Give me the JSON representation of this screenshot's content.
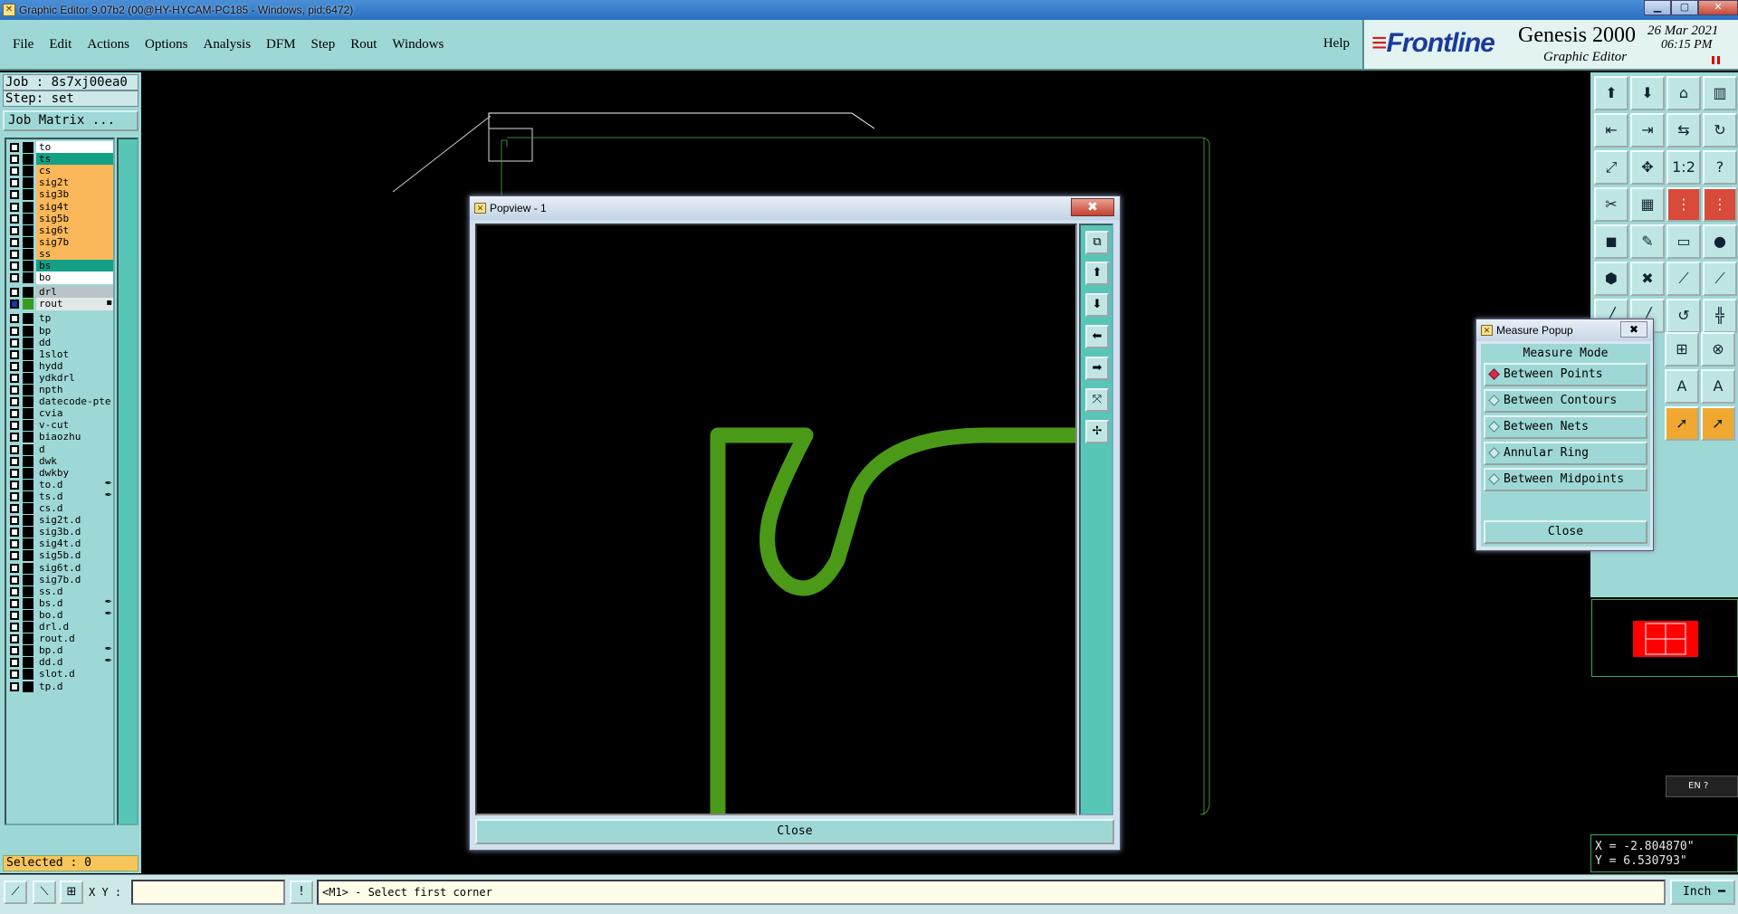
{
  "window": {
    "title": "Graphic Editor 9.07b2 (00@HY-HYCAM-PC185 - Windows, pid:6472)"
  },
  "menu": {
    "items": [
      "File",
      "Edit",
      "Actions",
      "Options",
      "Analysis",
      "DFM",
      "Step",
      "Rout",
      "Windows"
    ],
    "help": "Help"
  },
  "brand": {
    "logo": "Frontline",
    "product": "Genesis 2000",
    "subtitle": "Graphic Editor",
    "date": "26 Mar 2021",
    "time": "06:15 PM"
  },
  "job": {
    "job_label": "Job : 8s7xj00ea0",
    "step_label": "Step: set",
    "matrix_button": "Job Matrix ..."
  },
  "layers": [
    {
      "name": "to",
      "color": "#ffffff",
      "mark": ""
    },
    {
      "name": "ts",
      "color": "#13a085",
      "mark": ""
    },
    {
      "name": "cs",
      "color": "#fbb85a",
      "mark": ""
    },
    {
      "name": "sig2t",
      "color": "#fbb85a",
      "mark": ""
    },
    {
      "name": "sig3b",
      "color": "#fbb85a",
      "mark": ""
    },
    {
      "name": "sig4t",
      "color": "#fbb85a",
      "mark": ""
    },
    {
      "name": "sig5b",
      "color": "#fbb85a",
      "mark": ""
    },
    {
      "name": "sig6t",
      "color": "#fbb85a",
      "mark": ""
    },
    {
      "name": "sig7b",
      "color": "#fbb85a",
      "mark": ""
    },
    {
      "name": "ss",
      "color": "#fbb85a",
      "mark": ""
    },
    {
      "name": "bs",
      "color": "#13a085",
      "mark": ""
    },
    {
      "name": "bo",
      "color": "#ffffff",
      "mark": ""
    },
    {
      "name": "drl",
      "color": "#b8c4c6",
      "mark": ""
    },
    {
      "name": "rout",
      "color": "#e2e8e8",
      "mark": "▪"
    },
    {
      "name": "tp",
      "color": "#9ed8d6",
      "mark": ""
    },
    {
      "name": "bp",
      "color": "#9ed8d6",
      "mark": ""
    },
    {
      "name": "dd",
      "color": "#9ed8d6",
      "mark": ""
    },
    {
      "name": "1slot",
      "color": "#9ed8d6",
      "mark": ""
    },
    {
      "name": "hydd",
      "color": "#9ed8d6",
      "mark": ""
    },
    {
      "name": "ydkdrl",
      "color": "#9ed8d6",
      "mark": ""
    },
    {
      "name": "npth",
      "color": "#9ed8d6",
      "mark": ""
    },
    {
      "name": "datecode-pte",
      "color": "#9ed8d6",
      "mark": ""
    },
    {
      "name": "cvia",
      "color": "#9ed8d6",
      "mark": ""
    },
    {
      "name": "v-cut",
      "color": "#9ed8d6",
      "mark": ""
    },
    {
      "name": "biaozhu",
      "color": "#9ed8d6",
      "mark": ""
    },
    {
      "name": "d",
      "color": "#9ed8d6",
      "mark": ""
    },
    {
      "name": "dwk",
      "color": "#9ed8d6",
      "mark": ""
    },
    {
      "name": "dwkby",
      "color": "#9ed8d6",
      "mark": ""
    },
    {
      "name": "to.d",
      "color": "#9ed8d6",
      "mark": "✒"
    },
    {
      "name": "ts.d",
      "color": "#9ed8d6",
      "mark": "✒"
    },
    {
      "name": "cs.d",
      "color": "#9ed8d6",
      "mark": ""
    },
    {
      "name": "sig2t.d",
      "color": "#9ed8d6",
      "mark": ""
    },
    {
      "name": "sig3b.d",
      "color": "#9ed8d6",
      "mark": ""
    },
    {
      "name": "sig4t.d",
      "color": "#9ed8d6",
      "mark": ""
    },
    {
      "name": "sig5b.d",
      "color": "#9ed8d6",
      "mark": ""
    },
    {
      "name": "sig6t.d",
      "color": "#9ed8d6",
      "mark": ""
    },
    {
      "name": "sig7b.d",
      "color": "#9ed8d6",
      "mark": ""
    },
    {
      "name": "ss.d",
      "color": "#9ed8d6",
      "mark": ""
    },
    {
      "name": "bs.d",
      "color": "#9ed8d6",
      "mark": "✒"
    },
    {
      "name": "bo.d",
      "color": "#9ed8d6",
      "mark": "✒"
    },
    {
      "name": "drl.d",
      "color": "#9ed8d6",
      "mark": ""
    },
    {
      "name": "rout.d",
      "color": "#9ed8d6",
      "mark": ""
    },
    {
      "name": "bp.d",
      "color": "#9ed8d6",
      "mark": "✒"
    },
    {
      "name": "dd.d",
      "color": "#9ed8d6",
      "mark": "✒"
    },
    {
      "name": "slot.d",
      "color": "#9ed8d6",
      "mark": ""
    },
    {
      "name": "tp.d",
      "color": "#9ed8d6",
      "mark": ""
    }
  ],
  "selected": "Selected : 0",
  "popview": {
    "title": "Popview - 1",
    "close_label": "Close",
    "close_x": "✖"
  },
  "measure": {
    "title": "Measure Popup",
    "mode_label": "Measure Mode",
    "options": [
      "Between Points",
      "Between Contours",
      "Between Nets",
      "Annular Ring",
      "Between Midpoints"
    ],
    "active": 0,
    "close_label": "Close",
    "close_x": "✖"
  },
  "coords": {
    "x": "X = -2.804870\"",
    "y": "Y = 6.530793\""
  },
  "status": {
    "xy_label": "X Y :",
    "xy_value": "",
    "prompt": "<M1> - Select first corner",
    "unit": "Inch ━"
  },
  "lang": "EN",
  "colors": {
    "route": "#4a9a18",
    "panel": "#9ed8d6",
    "accent": "#58c6b6",
    "outline": "#3e8a3e"
  }
}
